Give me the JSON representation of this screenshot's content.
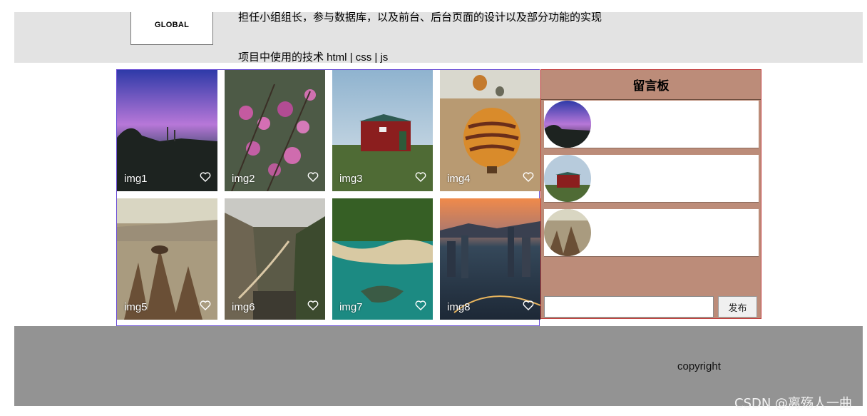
{
  "header": {
    "logo_text": "GLOBAL",
    "intro_clipped": "担任小组组长，参与数据库，以及前台、后台页面的设计以及部分功能的实现",
    "intro_tech": "项目中使用的技术 html | css | js"
  },
  "gallery": {
    "tiles": [
      {
        "label": "img1"
      },
      {
        "label": "img2"
      },
      {
        "label": "img3"
      },
      {
        "label": "img4"
      },
      {
        "label": "img5"
      },
      {
        "label": "img6"
      },
      {
        "label": "img7"
      },
      {
        "label": "img8"
      }
    ]
  },
  "board": {
    "title": "留言板",
    "input_value": "",
    "publish_label": "发布"
  },
  "footer": {
    "copyright": "copyright"
  },
  "watermark": "CSDN @离殇人一曲",
  "colors": {
    "header_bg": "#e3e3e3",
    "board_bg": "#bc8c79",
    "footer_bg": "#939393",
    "gallery_border": "#6a4dd6",
    "board_border": "#c23b3b"
  }
}
